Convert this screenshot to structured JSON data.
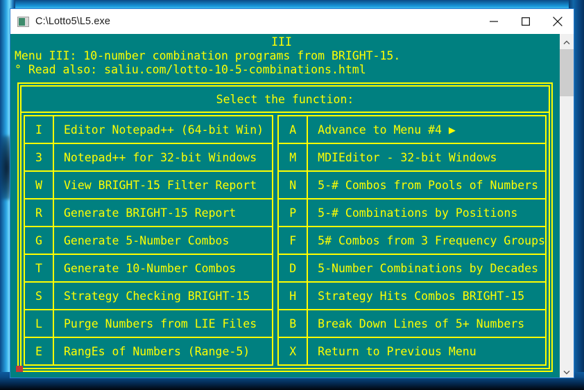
{
  "window": {
    "title": "C:\\Lotto5\\L5.exe",
    "icon": "console-app-icon",
    "controls": {
      "minimize": "minimize-icon",
      "maximize": "maximize-icon",
      "close": "close-icon"
    }
  },
  "console": {
    "header_roman": "III",
    "header_line1": "Menu III: 10-number combination programs from BRIGHT-15.",
    "header_line2": "° Read also: saliu.com/lotto-10-5-combinations.html",
    "select_prompt": "Select the function:",
    "colors": {
      "background": "#008080",
      "foreground": "#ffff00",
      "cursor": "#c03a3a"
    }
  },
  "menu": {
    "left_column": [
      {
        "key": "I",
        "label": "Editor Notepad++ (64-bit Win)"
      },
      {
        "key": "3",
        "label": "Notepad++ for 32-bit Windows"
      },
      {
        "key": "W",
        "label": "View BRIGHT-15 Filter Report"
      },
      {
        "key": "R",
        "label": "Generate BRIGHT-15 Report"
      },
      {
        "key": "G",
        "label": "Generate 5-Number Combos"
      },
      {
        "key": "T",
        "label": "Generate 10-Number Combos"
      },
      {
        "key": "S",
        "label": "Strategy Checking BRIGHT-15"
      },
      {
        "key": "L",
        "label": "Purge Numbers from LIE Files"
      },
      {
        "key": "E",
        "label": "RangEs of Numbers (Range-5)"
      }
    ],
    "right_column": [
      {
        "key": "A",
        "label": "Advance to Menu #4 ▶"
      },
      {
        "key": "M",
        "label": "MDIEditor - 32-bit Windows"
      },
      {
        "key": "N",
        "label": "5-# Combos from Pools of Numbers"
      },
      {
        "key": "P",
        "label": "5-# Combinations by Positions"
      },
      {
        "key": "F",
        "label": "5# Combos from 3 Frequency Groups"
      },
      {
        "key": "D",
        "label": "5-Number Combinations by Decades"
      },
      {
        "key": "H",
        "label": "Strategy Hits Combos BRIGHT-15"
      },
      {
        "key": "B",
        "label": "Break Down Lines of 5+ Numbers"
      },
      {
        "key": "X",
        "label": "Return to Previous Menu"
      }
    ]
  },
  "scrollbar": {
    "up_arrow": "chevron-up-icon",
    "down_arrow": "chevron-down-icon"
  }
}
